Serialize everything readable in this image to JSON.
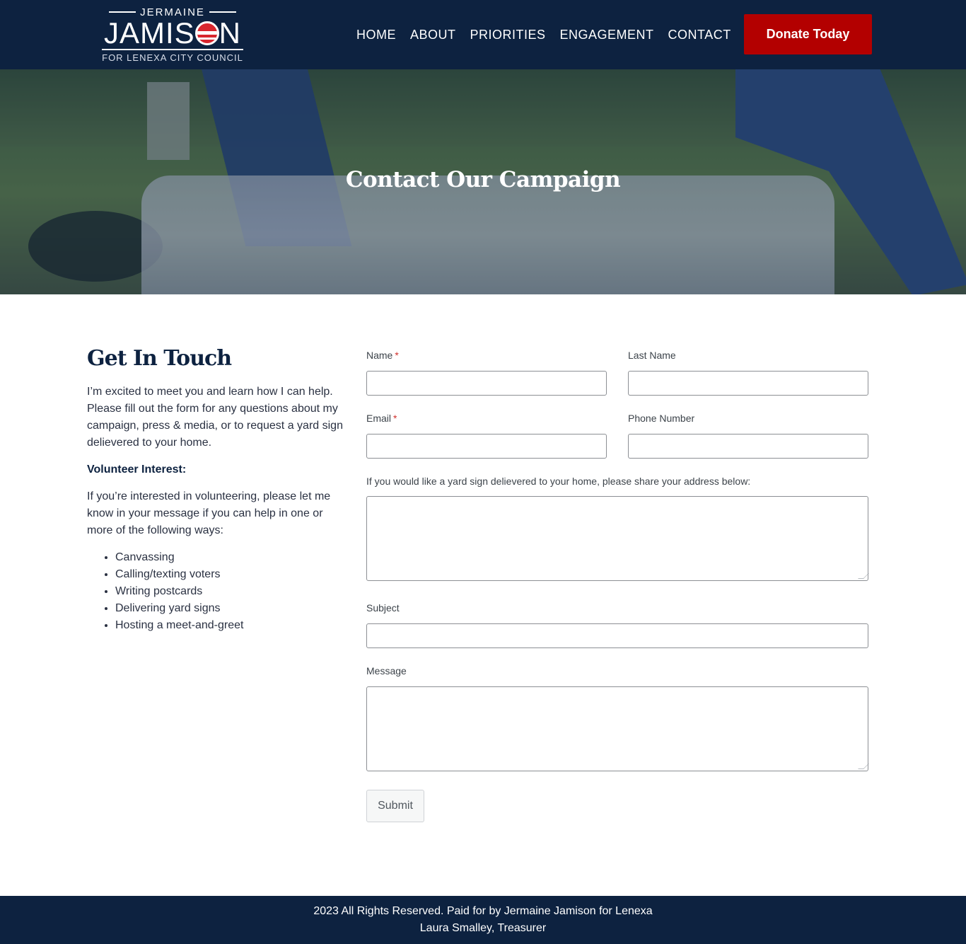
{
  "brand": {
    "top": "JERMAINE",
    "main_prefix": "JAMIS",
    "main_suffix": "N",
    "sub": "FOR LENEXA CITY COUNCIL"
  },
  "nav": {
    "items": [
      "HOME",
      "ABOUT",
      "PRIORITIES",
      "ENGAGEMENT",
      "CONTACT"
    ],
    "donate": "Donate Today"
  },
  "hero": {
    "title": "Contact Our Campaign"
  },
  "contact": {
    "heading": "Get In Touch",
    "intro": "I’m excited to meet you and learn how I can help. Please fill out the form for any questions about my campaign, press & media, or to request a yard sign delievered to your home.",
    "volunteer_title": "Volunteer Interest:",
    "volunteer_text": "If you’re interested in volunteering, please let me know in your message if you can help in one or more of the following ways:",
    "volunteer_ways": [
      "Canvassing",
      "Calling/texting voters",
      "Writing postcards",
      "Delivering yard signs",
      "Hosting a meet-and-greet"
    ]
  },
  "form": {
    "name_label": "Name",
    "last_name_label": "Last Name",
    "email_label": "Email",
    "phone_label": "Phone Number",
    "address_label": "If you would like a yard sign delievered to your home, please share your address below:",
    "subject_label": "Subject",
    "message_label": "Message",
    "required_mark": "*",
    "submit": "Submit"
  },
  "footer": {
    "line1": "2023 All Rights Reserved. Paid for by Jermaine Jamison for Lenexa",
    "line2": "Laura Smalley, Treasurer"
  },
  "colors": {
    "navy": "#0d2240",
    "donate_red": "#b30000",
    "required_red": "#d0312d"
  }
}
